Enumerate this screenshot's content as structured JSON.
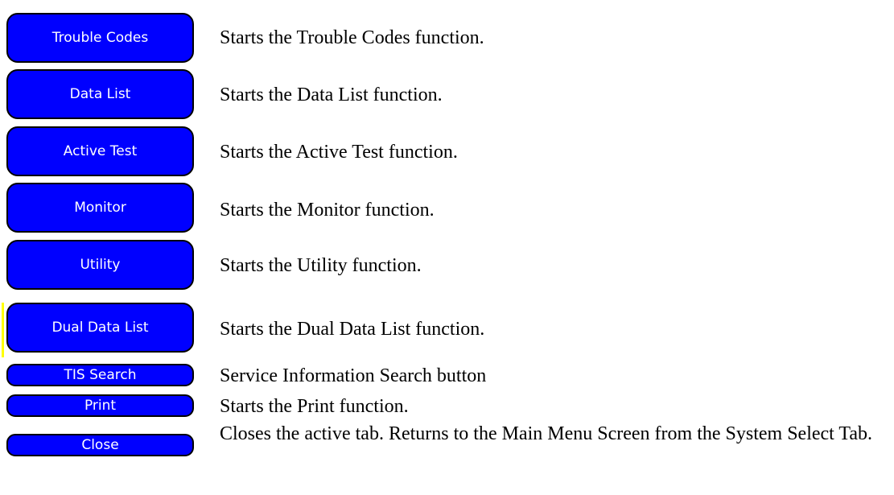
{
  "items": [
    {
      "button": "Trouble Codes",
      "description": "Starts the Trouble Codes function."
    },
    {
      "button": "Data List",
      "description": "Starts the Data List function."
    },
    {
      "button": "Active Test",
      "description": "Starts the Active Test function."
    },
    {
      "button": "Monitor",
      "description": "Starts the Monitor function."
    },
    {
      "button": "Utility",
      "description": "Starts the Utility function."
    },
    {
      "button": "Dual Data List",
      "description": "Starts the Dual Data List function."
    },
    {
      "button": "TIS Search",
      "description": "Service Information Search button"
    },
    {
      "button": "Print",
      "description": "Starts the Print function."
    },
    {
      "button": "Close",
      "description": "Closes the active tab. Returns to the Main Menu Screen from the System Select Tab."
    }
  ],
  "colors": {
    "button_fill": "#0000ff",
    "button_border": "#000000",
    "button_text": "#ffffff",
    "selection_marker": "#ffff00"
  }
}
